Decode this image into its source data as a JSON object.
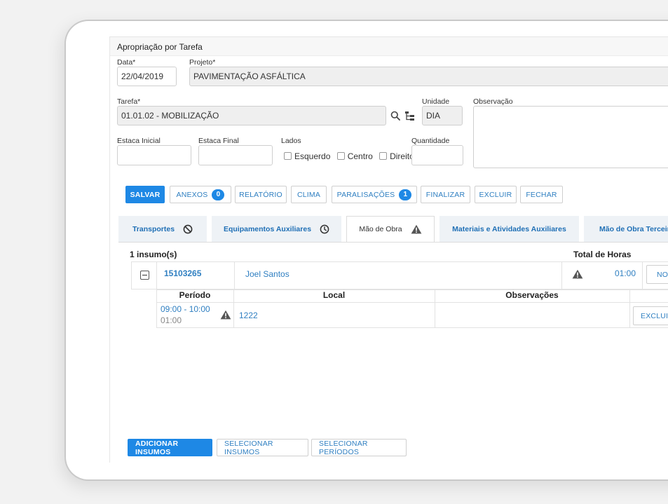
{
  "window_title": "Apropriação por Tarefa",
  "form": {
    "data_label": "Data*",
    "data_value": "22/04/2019",
    "projeto_label": "Projeto*",
    "projeto_value": "PAVIMENTAÇÃO ASFÁLTICA",
    "tarefa_label": "Tarefa*",
    "tarefa_value": "01.01.02 - MOBILIZAÇÃO",
    "unidade_label": "Unidade",
    "unidade_value": "DIA",
    "observacao_label": "Observação",
    "estaca_inicial_label": "Estaca Inicial",
    "estaca_final_label": "Estaca Final",
    "lados_label": "Lados",
    "lado_esquerdo": "Esquerdo",
    "lado_centro": "Centro",
    "lado_direito": "Direito",
    "quantidade_label": "Quantidade"
  },
  "toolbar": {
    "salvar": "SALVAR",
    "anexos": "ANEXOS",
    "anexos_count": "0",
    "relatorio": "RELATÓRIO",
    "clima": "CLIMA",
    "paralisacoes": "PARALISAÇÕES",
    "paralisacoes_count": "1",
    "finalizar": "FINALIZAR",
    "excluir": "EXCLUIR",
    "fechar": "FECHAR"
  },
  "tabs": [
    {
      "label": "Transportes",
      "icon": "ban-icon"
    },
    {
      "label": "Equipamentos Auxiliares",
      "icon": "clock-icon"
    },
    {
      "label": "Mão de Obra",
      "icon": "warning-icon"
    },
    {
      "label": "Materiais e Atividades Auxiliares",
      "icon": ""
    },
    {
      "label": "Mão de Obra Terceiro",
      "icon": ""
    }
  ],
  "insumos": {
    "count_label": "1 insumo(s)",
    "total_horas_label": "Total de Horas",
    "row": {
      "code": "15103265",
      "name": "Joel Santos",
      "total": "01:00",
      "novo_button": "NOVO"
    },
    "periodos": {
      "headers": [
        "Período",
        "Local",
        "Observações"
      ],
      "rows": [
        {
          "periodo": "09:00 - 10:00",
          "duracao": "01:00",
          "local": "1222",
          "observacoes": "",
          "excluir": "EXCLUIR"
        }
      ]
    }
  },
  "footer": {
    "adicionar": "ADICIONAR INSUMOS",
    "selecionar_insumos": "SELECIONAR INSUMOS",
    "selecionar_periodos": "SELECIONAR PERÍODOS"
  },
  "colors": {
    "primary": "#1e88e5",
    "link": "#2f7fc1",
    "tab_bg": "#eef2f6"
  }
}
